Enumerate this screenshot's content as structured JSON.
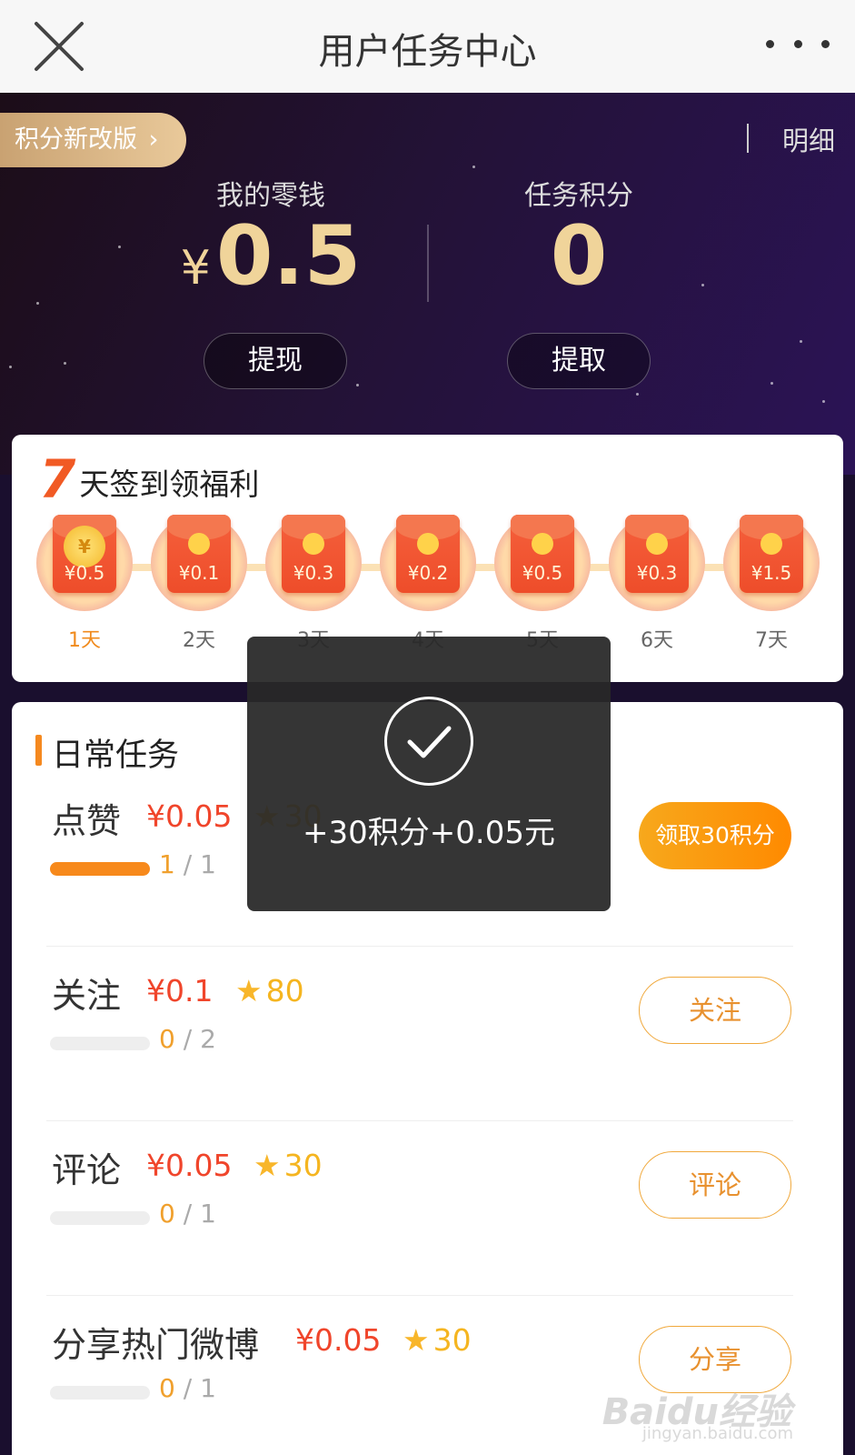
{
  "nav": {
    "title": "用户任务中心"
  },
  "header": {
    "version_label": "积分新改版",
    "detail_label": "明细",
    "wallet": {
      "label": "我的零钱",
      "currency": "¥",
      "value": "0.5",
      "button": "提现"
    },
    "points": {
      "label": "任务积分",
      "value": "0",
      "button": "提取"
    }
  },
  "checkin": {
    "title_number": "7",
    "title_text": "天签到领福利",
    "days": [
      {
        "amount": "¥0.5",
        "label": "1天",
        "active": true
      },
      {
        "amount": "¥0.1",
        "label": "2天"
      },
      {
        "amount": "¥0.3",
        "label": "3天"
      },
      {
        "amount": "¥0.2",
        "label": "4天"
      },
      {
        "amount": "¥0.5",
        "label": "5天"
      },
      {
        "amount": "¥0.3",
        "label": "6天"
      },
      {
        "amount": "¥1.5",
        "label": "7天"
      }
    ],
    "coin_symbol": "¥"
  },
  "tasks": {
    "title": "日常任务",
    "items": [
      {
        "name": "点赞",
        "money": "¥0.05",
        "points": "30",
        "done": "1",
        "sep": "/",
        "total": "1",
        "progress": 1.0,
        "button": "领取30积分"
      },
      {
        "name": "关注",
        "money": "¥0.1",
        "points": "80",
        "done": "0",
        "sep": "/",
        "total": "2",
        "progress": 0,
        "button": "关注"
      },
      {
        "name": "评论",
        "money": "¥0.05",
        "points": "30",
        "done": "0",
        "sep": "/",
        "total": "1",
        "progress": 0,
        "button": "评论"
      },
      {
        "name": "分享热门微博",
        "money": "¥0.05",
        "points": "30",
        "done": "0",
        "sep": "/",
        "total": "1",
        "progress": 0,
        "button": "分享"
      }
    ]
  },
  "toast": {
    "text": "+30积分+0.05元"
  },
  "watermark": {
    "main": "Baidu经验",
    "sub": "jingyan.baidu.com"
  },
  "colors": {
    "accent": "#f7891b",
    "money": "#f0452b",
    "points": "#f5b520",
    "gold": "#f0d49a"
  }
}
